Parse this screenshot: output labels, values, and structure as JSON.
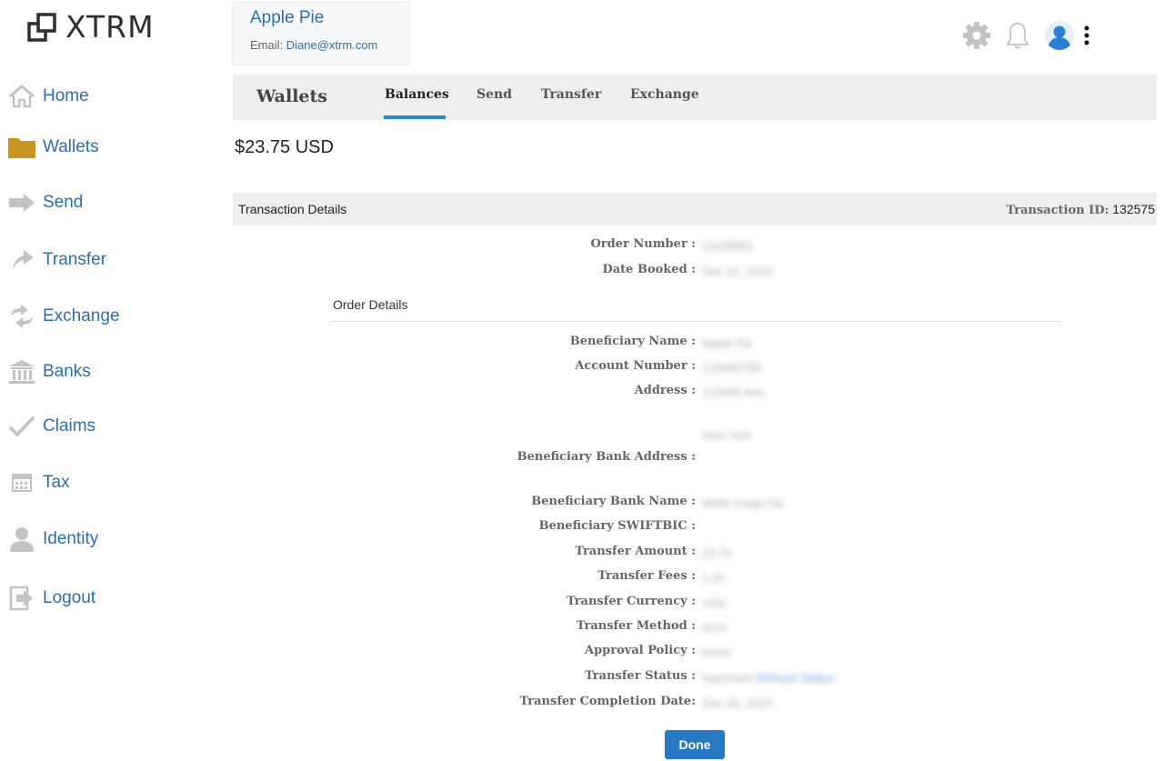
{
  "brand": {
    "name": "XTRM"
  },
  "sidebar": {
    "items": [
      {
        "label": "Home",
        "icon": "home-icon"
      },
      {
        "label": "Wallets",
        "icon": "folder-icon"
      },
      {
        "label": "Send",
        "icon": "arrow-right-icon"
      },
      {
        "label": "Transfer",
        "icon": "transfer-arrow-icon"
      },
      {
        "label": "Exchange",
        "icon": "exchange-icon"
      },
      {
        "label": "Banks",
        "icon": "bank-icon"
      },
      {
        "label": "Claims",
        "icon": "checkmark-icon"
      },
      {
        "label": "Tax",
        "icon": "calculator-icon"
      },
      {
        "label": "Identity",
        "icon": "person-icon"
      },
      {
        "label": "Logout",
        "icon": "logout-icon"
      }
    ]
  },
  "user": {
    "name": "Apple Pie",
    "email_label": "Email: ",
    "email": "Diane@xtrm.com"
  },
  "header_icons": [
    "gear-icon",
    "bell-icon",
    "avatar-icon",
    "more-vertical-icon"
  ],
  "tabbar": {
    "title": "Wallets",
    "tabs": [
      {
        "label": "Balances",
        "active": true
      },
      {
        "label": "Send",
        "active": false
      },
      {
        "label": "Transfer",
        "active": false
      },
      {
        "label": "Exchange",
        "active": false
      }
    ]
  },
  "balance": "$23.75 USD",
  "details": {
    "title": "Transaction Details",
    "transaction_id_label": "Transaction ID:",
    "transaction_id": "132575",
    "order_number_label": "Order Number :",
    "order_number": "11038861",
    "date_booked_label": "Date Booked :",
    "date_booked": "Dec 21, 2023",
    "order_details_title": "Order Details",
    "beneficiary_name_label": "Beneficiary Name :",
    "beneficiary_name": "Apple Pie",
    "account_number_label": "Account Number :",
    "account_number": "123456789",
    "address_label": "Address :",
    "address_line1": "123456 Ave",
    "address_line2": "New York",
    "bank_address_label": "Beneficiary Bank Address :",
    "bank_name_label": "Beneficiary Bank Name :",
    "bank_name": "Wells Fargo Na",
    "swift_label": "Beneficiary SWIFTBIC :",
    "transfer_amount_label": "Transfer Amount :",
    "transfer_amount": "23.75",
    "transfer_fees_label": "Transfer Fees :",
    "transfer_fees": "1.25",
    "transfer_currency_label": "Transfer Currency :",
    "transfer_currency": "USD",
    "transfer_method_label": "Transfer Method :",
    "transfer_method": "ACH",
    "approval_policy_label": "Approval Policy :",
    "approval_policy": "None",
    "transfer_status_label": "Transfer Status :",
    "transfer_status": "Approved",
    "refresh_status": "Refresh Status",
    "completion_date_label": "Transfer Completion Date:",
    "completion_date": "Dec 26, 2023"
  },
  "done_button": "Done",
  "colors": {
    "link": "#2b6fb2",
    "accent": "#2b8cc4",
    "button": "#2878c3",
    "icon_gray": "#c3c3c3",
    "wallet_folder": "#c8961e",
    "avatar_blue": "#2b7fd4"
  }
}
